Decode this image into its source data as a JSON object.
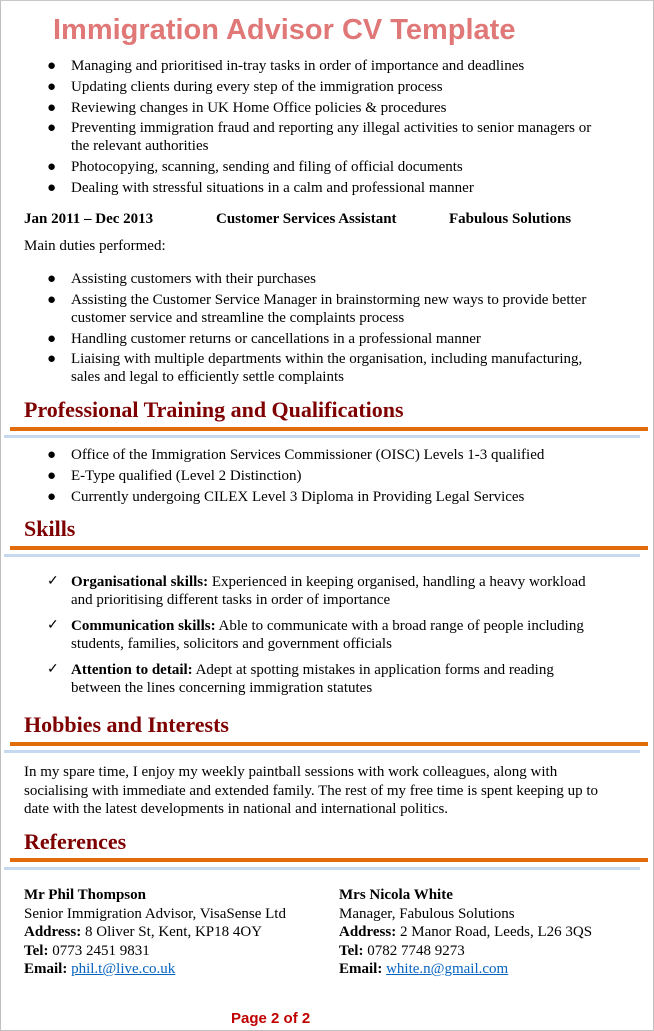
{
  "document": {
    "title": "Immigration Advisor CV Template",
    "previous_role_duties": [
      "Managing and prioritised in-tray tasks in order of importance and deadlines",
      "Updating clients during every step of the immigration  process",
      "Reviewing changes in UK Home Office policies & procedures",
      "Preventing immigration  fraud and reporting any illegal activities to senior managers or the relevant authorities",
      "Photocopying, scanning, sending and filing of official documents",
      "Dealing with stressful situations in a calm and professional manner"
    ],
    "job": {
      "dates": "Jan 2011 – Dec 2013",
      "position": "Customer Services Assistant",
      "company": "Fabulous Solutions",
      "duties_label": "Main duties performed:",
      "duties": [
        "Assisting customers with their purchases",
        "Assisting the Customer Service Manager in brainstorming new ways to provide better customer service and streamline the complaints process",
        "Handling customer returns or cancellations in a professional manner",
        "Liaising with multiple departments within the organisation, including manufacturing, sales and legal to efficiently settle complaints"
      ]
    },
    "training": {
      "heading": "Professional Training and Qualifications",
      "items": [
        "Office of the Immigration Services Commissioner (OISC) Levels 1-3 qualified",
        "E-Type qualified (Level 2 Distinction)",
        "Currently undergoing CILEX Level 3 Diploma in Providing Legal Services"
      ]
    },
    "skills": {
      "heading": "Skills",
      "items": [
        {
          "label": "Organisational skills:",
          "text": " Experienced in keeping organised, handling a heavy workload and prioritising  different tasks in order of importance"
        },
        {
          "label": "Communication skills:",
          "text": " Able to communicate with a broad range of people including students, families,  solicitors and government officials"
        },
        {
          "label": "Attention to detail:",
          "text": " Adept at spotting mistakes in application forms and reading between the lines concerning immigration statutes"
        }
      ]
    },
    "hobbies": {
      "heading": "Hobbies and Interests",
      "text": "In my spare time, I enjoy my weekly paintball sessions with work colleagues,  along with socialising  with immediate and extended family. The rest of my free time is spent keeping up to date with the latest developments in national and international politics."
    },
    "references": {
      "heading": "References",
      "items": [
        {
          "name": "Mr Phil Thompson",
          "role": "Senior Immigration Advisor, VisaSense Ltd",
          "address_label": "Address:",
          "address": " 8 Oliver St, Kent, KP18 4OY",
          "tel_label": "Tel:",
          "tel": " 0773 2451 9831",
          "email_label": "Email:",
          "email": "phil.t@live.co.uk"
        },
        {
          "name": "Mrs Nicola White",
          "role": "Manager, Fabulous Solutions",
          "address_label": "Address:",
          "address": " 2 Manor Road, Leeds, L26 3QS",
          "tel_label": "Tel:",
          "tel": " 0782 7748 9273",
          "email_label": "Email:",
          "email": "white.n@gmail.com"
        }
      ]
    },
    "footer": "Page 2 of 2",
    "colors": {
      "title": "#e07878",
      "heading": "#7f0000",
      "rule_orange": "#e36c0a",
      "rule_blue": "#c6d9f1",
      "link": "#0563c1",
      "footer": "#c00000"
    }
  }
}
